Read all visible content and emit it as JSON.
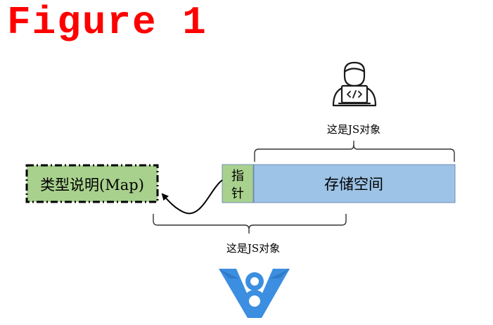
{
  "figure_title": "Figure 1",
  "type_box": {
    "label": "类型说明(Map)"
  },
  "pointer_box": {
    "label_line1": "指",
    "label_line2": "针"
  },
  "storage_box": {
    "label": "存储空间"
  },
  "top_caption": "这是JS对象",
  "bottom_caption": "这是JS对象",
  "icons": {
    "developer": "developer-laptop-icon",
    "engine": "v8-logo-icon"
  },
  "colors": {
    "title": "#ff0000",
    "green_fill": "#a9d18e",
    "blue_fill": "#9dc3e6",
    "border": "#000000"
  }
}
